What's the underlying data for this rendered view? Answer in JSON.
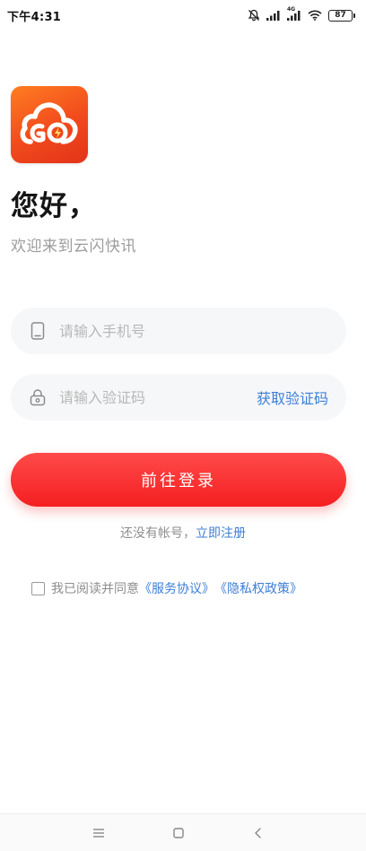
{
  "status_bar": {
    "time": "下午4:31",
    "signal_tag_1": "4G",
    "signal_tag_2": "4G",
    "battery_level": "87",
    "icons": [
      "bell-mute-icon",
      "signal-icon",
      "signal-icon",
      "wifi-icon",
      "battery-icon"
    ]
  },
  "app": {
    "logo_icon": "cloud-lightning-logo",
    "brand_colors": {
      "logo_orange": "#ff7d22",
      "logo_red": "#e3331a"
    }
  },
  "greeting": {
    "title": "您好，",
    "subtitle": "欢迎来到云闪快讯"
  },
  "form": {
    "phone_placeholder": "请输入手机号",
    "phone_icon": "phone-icon",
    "code_placeholder": "请输入验证码",
    "code_icon": "lock-icon",
    "get_code_label": "获取验证码",
    "login_label": "前往登录"
  },
  "register": {
    "prompt": "还没有帐号，",
    "link": "立即注册"
  },
  "agreement": {
    "checked": false,
    "prefix": "我已阅读并同意",
    "service_link": "《服务协议》",
    "privacy_link": "《隐私权政策》"
  },
  "nav_bar": {
    "icons": [
      "menu-icon",
      "home-icon",
      "back-icon"
    ]
  },
  "colors": {
    "accent_red": "#f41f20",
    "link_blue": "#3d7fd6",
    "field_bg": "#f6f7f9"
  }
}
